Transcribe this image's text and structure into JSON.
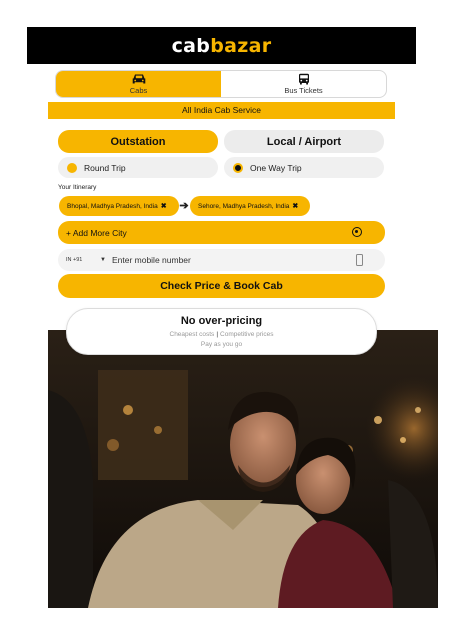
{
  "brand": {
    "part1": "cab",
    "part2": "bazar"
  },
  "tabs": [
    {
      "label": "Cabs",
      "icon": "car-icon",
      "active": true
    },
    {
      "label": "Bus Tickets",
      "icon": "bus-icon",
      "active": false
    }
  ],
  "banner": "All India Cab Service",
  "trip_types": {
    "outstation": "Outstation",
    "local": "Local / Airport",
    "selected": "Outstation"
  },
  "trip_options": {
    "round": "Round Trip",
    "oneway": "One Way Trip",
    "selected": "One Way Trip"
  },
  "itinerary": {
    "label": "Your Itinerary",
    "from": "Bhopal, Madhya Pradesh, India",
    "to": "Sehore, Madhya Pradesh, India",
    "remove_glyph": "✖",
    "arrow_glyph": "➔"
  },
  "add_city": "+ Add More City",
  "phone": {
    "country_code": "IN +91",
    "placeholder": "Enter mobile number",
    "value": ""
  },
  "check_button": "Check Price & Book Cab",
  "pricing": {
    "title": "No over-pricing",
    "line1a": "Cheapest costs",
    "divider": "|",
    "line1b": "Competitive prices",
    "line2": "Pay as you go"
  },
  "colors": {
    "accent": "#f7b500",
    "header_bg": "#000000"
  }
}
